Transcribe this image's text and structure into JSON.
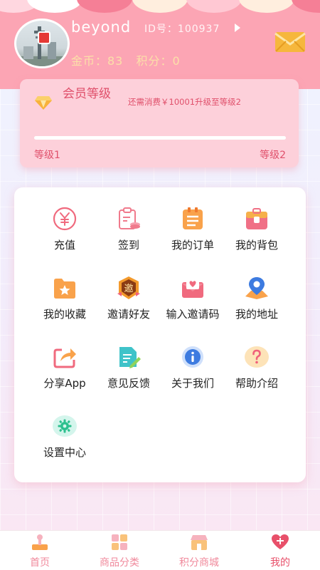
{
  "user": {
    "name": "beyond",
    "id_text": "ID号：100937",
    "coins_text": "金币：83",
    "score_text": "积分：0"
  },
  "membership": {
    "title": "会员等级",
    "hint": "还需消费￥10001升级至等级2",
    "level_current": "等级1",
    "level_next": "等级2",
    "progress": 0
  },
  "menu": {
    "items": [
      {
        "label": "充值",
        "icon": "yen-coin-icon"
      },
      {
        "label": "签到",
        "icon": "checkin-clipboard-icon"
      },
      {
        "label": "我的订单",
        "icon": "order-list-icon"
      },
      {
        "label": "我的背包",
        "icon": "backpack-icon"
      },
      {
        "label": "我的收藏",
        "icon": "favorite-folder-icon"
      },
      {
        "label": "邀请好友",
        "icon": "invite-badge-icon"
      },
      {
        "label": "输入邀请码",
        "icon": "invite-code-envelope-icon"
      },
      {
        "label": "我的地址",
        "icon": "location-pin-icon"
      },
      {
        "label": "分享App",
        "icon": "share-icon"
      },
      {
        "label": "意见反馈",
        "icon": "feedback-edit-icon"
      },
      {
        "label": "关于我们",
        "icon": "info-icon"
      },
      {
        "label": "帮助介绍",
        "icon": "help-icon"
      },
      {
        "label": "设置中心",
        "icon": "settings-gear-icon"
      }
    ],
    "badge_char": "邀"
  },
  "tabbar": {
    "tabs": [
      {
        "label": "首页",
        "icon": "home-joystick-icon"
      },
      {
        "label": "商品分类",
        "icon": "category-grid-icon"
      },
      {
        "label": "积分商城",
        "icon": "points-store-icon"
      },
      {
        "label": "我的",
        "icon": "profile-heart-icon"
      }
    ],
    "active_index": 3
  },
  "colors": {
    "header_bg": "#fca5b4",
    "accent": "#e8506a",
    "card_bg": "#fdd0da",
    "coin_text": "#fbe0a8"
  }
}
